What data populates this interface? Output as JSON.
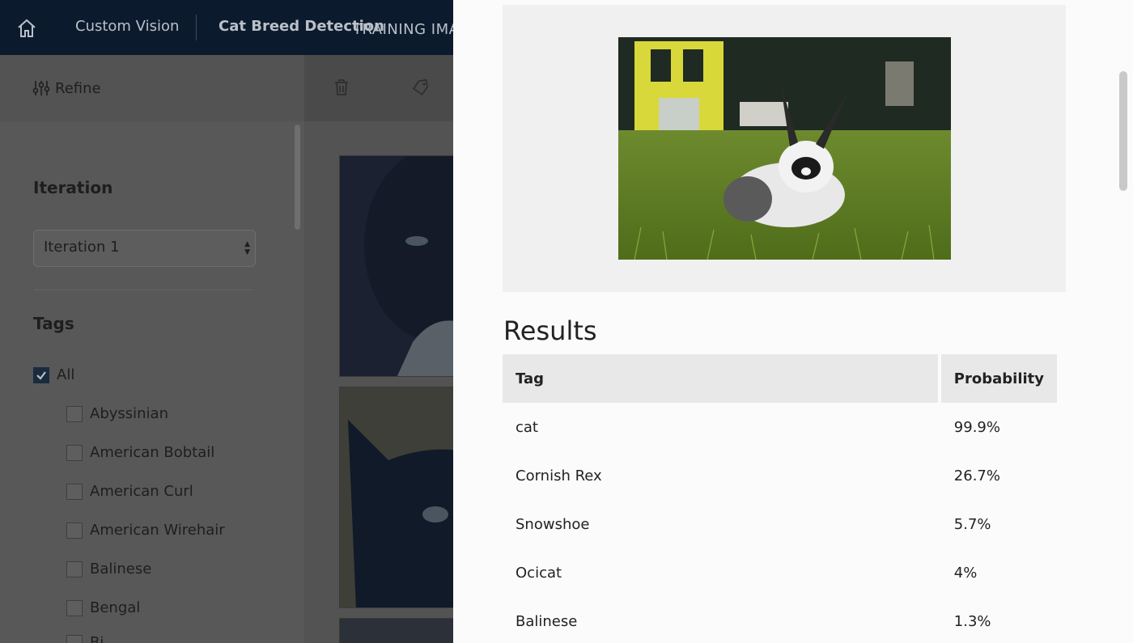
{
  "header": {
    "brand": "Custom Vision",
    "project": "Cat Breed Detection",
    "section": "TRAINING IMA"
  },
  "sidebar": {
    "refine_label": "Refine",
    "iteration_heading": "Iteration",
    "iteration_value": "Iteration 1",
    "tags_heading": "Tags",
    "tags": [
      {
        "label": "All",
        "checked": true
      },
      {
        "label": "Abyssinian",
        "checked": false
      },
      {
        "label": "American Bobtail",
        "checked": false
      },
      {
        "label": "American Curl",
        "checked": false
      },
      {
        "label": "American Wirehair",
        "checked": false
      },
      {
        "label": "Balinese",
        "checked": false
      },
      {
        "label": "Bengal",
        "checked": false
      },
      {
        "label": "Bi",
        "checked": false
      }
    ]
  },
  "results": {
    "heading": "Results",
    "columns": {
      "tag": "Tag",
      "probability": "Probability"
    },
    "rows": [
      {
        "tag": "cat",
        "probability": "99.9%"
      },
      {
        "tag": "Cornish Rex",
        "probability": "26.7%"
      },
      {
        "tag": "Snowshoe",
        "probability": "5.7%"
      },
      {
        "tag": "Ocicat",
        "probability": "4%"
      },
      {
        "tag": "Balinese",
        "probability": "1.3%"
      }
    ]
  },
  "icons": [
    "home-icon",
    "sliders-icon",
    "trash-icon",
    "tag-icon",
    "chevron-updown-icon",
    "checkmark-icon"
  ],
  "colors": {
    "topbar": "#0c1a2d",
    "overlay": "#585858",
    "panel": "#fbfbfb",
    "table_header": "#e8e8e8"
  }
}
